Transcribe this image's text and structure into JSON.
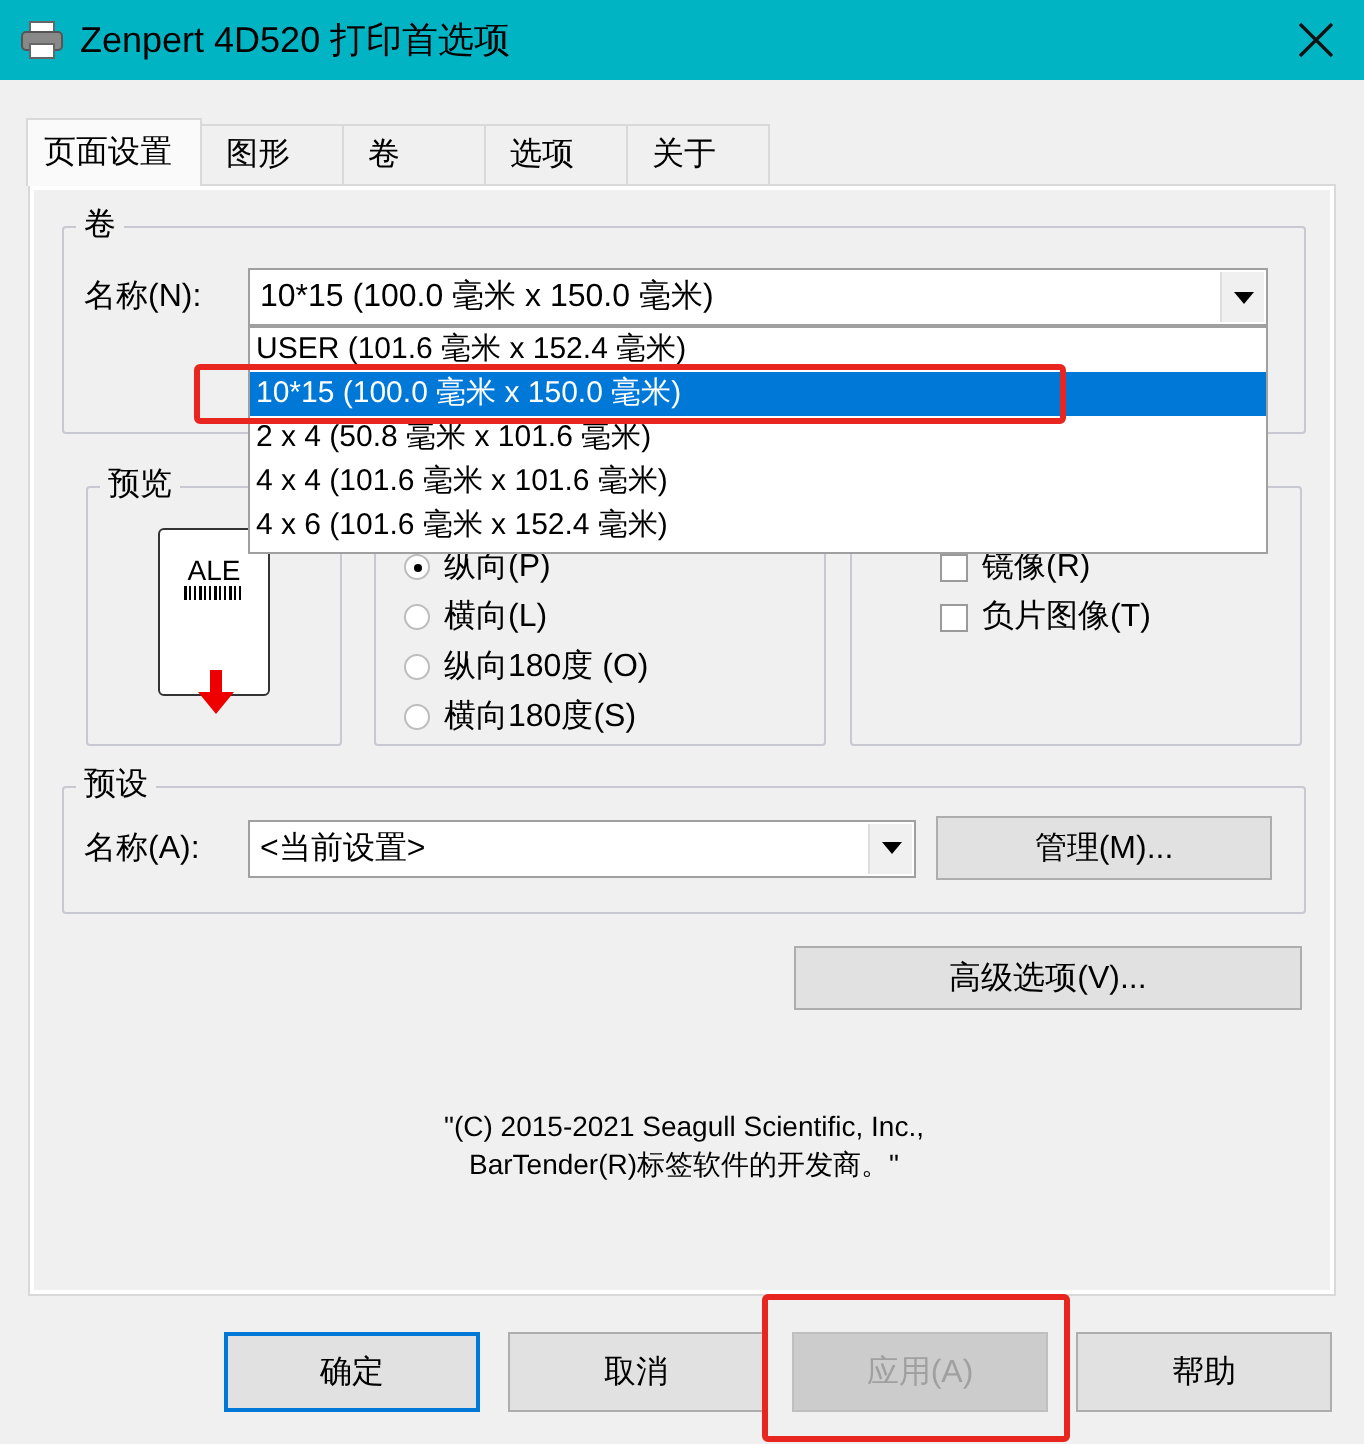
{
  "window": {
    "title": "Zenpert 4D520 打印首选项"
  },
  "tabs": [
    {
      "label": "页面设置",
      "selected": true
    },
    {
      "label": "图形",
      "selected": false
    },
    {
      "label": "卷",
      "selected": false
    },
    {
      "label": "选项",
      "selected": false
    },
    {
      "label": "关于",
      "selected": false
    }
  ],
  "roll_group": {
    "title": "卷",
    "name_label": "名称(N):",
    "value": "10*15 (100.0 毫米 x 150.0 毫米)",
    "dropdown": [
      {
        "label": "USER (101.6 毫米 x 152.4 毫米)",
        "selected": false,
        "highlighted": false
      },
      {
        "label": "10*15 (100.0 毫米 x 150.0 毫米)",
        "selected": true,
        "highlighted": true
      },
      {
        "label": "2 x 4 (50.8 毫米 x 101.6 毫米)",
        "selected": false,
        "highlighted": false
      },
      {
        "label": "4 x 4 (101.6 毫米 x 101.6 毫米)",
        "selected": false,
        "highlighted": false
      },
      {
        "label": "4 x 6 (101.6 毫米 x 152.4 毫米)",
        "selected": false,
        "highlighted": false
      }
    ]
  },
  "preview_group": {
    "title": "预览",
    "label": "ALE"
  },
  "orientation": [
    {
      "label": "纵向(P)",
      "selected": true
    },
    {
      "label": "横向(L)",
      "selected": false
    },
    {
      "label": "纵向180度 (O)",
      "selected": false
    },
    {
      "label": "横向180度(S)",
      "selected": false
    }
  ],
  "options": [
    {
      "label": "镜像(R)",
      "checked": false
    },
    {
      "label": "负片图像(T)",
      "checked": false
    }
  ],
  "preset_group": {
    "title": "预设",
    "name_label": "名称(A):",
    "value": "<当前设置>",
    "button": "管理(M)..."
  },
  "advanced_button": "高级选项(V)...",
  "copyright": [
    "\"(C) 2015-2021 Seagull Scientific, Inc.,",
    "BarTender(R)标签软件的开发商。\""
  ],
  "buttons": [
    {
      "label": "确定",
      "default": true,
      "disabled": false,
      "highlighted": false
    },
    {
      "label": "取消",
      "default": false,
      "disabled": false,
      "highlighted": false
    },
    {
      "label": "应用(A)",
      "default": false,
      "disabled": true,
      "highlighted": true
    },
    {
      "label": "帮助",
      "default": false,
      "disabled": false,
      "highlighted": false
    }
  ]
}
